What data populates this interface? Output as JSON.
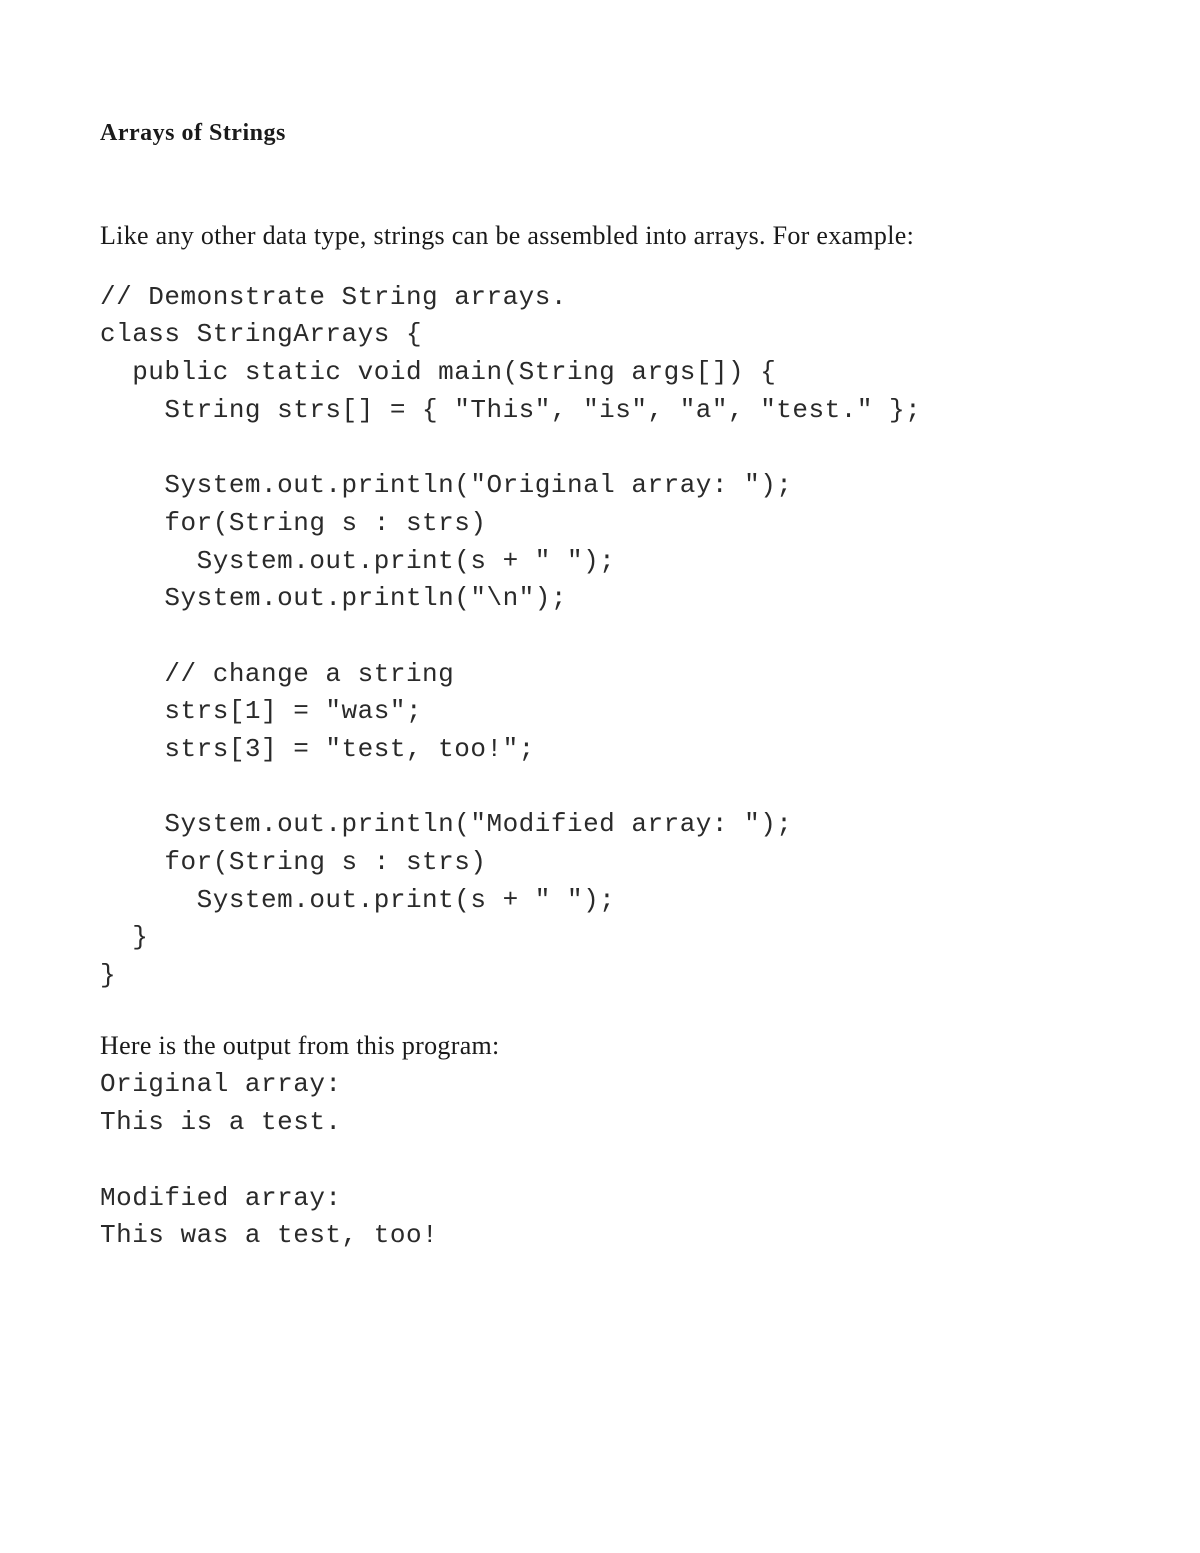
{
  "title": "Arrays of Strings",
  "intro": "Like any other data type, strings can be assembled into arrays. For example:",
  "code": "// Demonstrate String arrays.\nclass StringArrays {\n  public static void main(String args[]) {\n    String strs[] = { \"This\", \"is\", \"a\", \"test.\" };\n\n    System.out.println(\"Original array: \");\n    for(String s : strs)\n      System.out.print(s + \" \");\n    System.out.println(\"\\n\");\n\n    // change a string\n    strs[1] = \"was\";\n    strs[3] = \"test, too!\";\n\n    System.out.println(\"Modified array: \");\n    for(String s : strs)\n      System.out.print(s + \" \");\n  }\n}",
  "outputIntro": "Here is the output from this program:",
  "output": "Original array:\nThis is a test.\n\nModified array:\nThis was a test, too!"
}
